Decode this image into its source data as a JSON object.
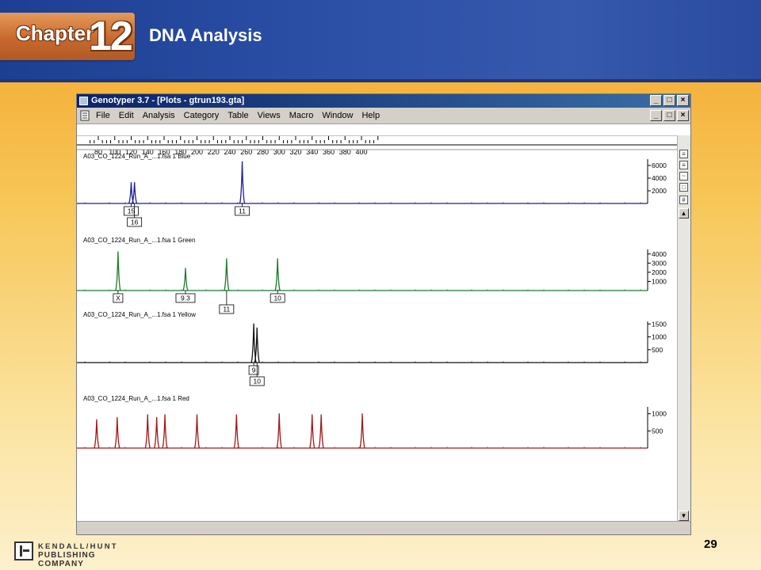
{
  "header": {
    "chapter_word": "Chapter",
    "chapter_number": "12",
    "title": "DNA Analysis"
  },
  "window": {
    "title": "Genotyper 3.7 - [Plots - gtrun193.gta]",
    "controls": [
      "_",
      "□",
      "×"
    ]
  },
  "menubar": {
    "items": [
      "File",
      "Edit",
      "Analysis",
      "Category",
      "Table",
      "Views",
      "Macro",
      "Window",
      "Help"
    ]
  },
  "ruler": {
    "ticks": [
      "80",
      "100",
      "120",
      "140",
      "160",
      "180",
      "200",
      "220",
      "240",
      "260",
      "280",
      "300",
      "320",
      "340",
      "360",
      "380",
      "400"
    ]
  },
  "panels": [
    {
      "label": "A03_CO_1224_Run_A_...1.fsa  1 Blue",
      "color": "#1f1f8f",
      "y_ticks": [
        "6000",
        "4000",
        "2000"
      ],
      "y_tick_values": [
        6000,
        4000,
        2000
      ],
      "y_max": 7000,
      "peaks": [
        {
          "x": 120,
          "h": 0.48
        },
        {
          "x": 124,
          "h": 0.48
        },
        {
          "x": 255,
          "h": 0.95
        }
      ],
      "alleles": [
        {
          "x": 120,
          "label": "15",
          "row": 0
        },
        {
          "x": 124,
          "label": "16",
          "row": 1
        },
        {
          "x": 255,
          "label": "11",
          "row": 0
        }
      ]
    },
    {
      "label": "A03_CO_1224_Run_A_...1.fsa  1 Green",
      "color": "#1a7a2a",
      "y_ticks": [
        "4000",
        "3000",
        "2000",
        "1000"
      ],
      "y_tick_values": [
        4000,
        3000,
        2000,
        1000
      ],
      "y_max": 4500,
      "peaks": [
        {
          "x": 104,
          "h": 0.95
        },
        {
          "x": 186,
          "h": 0.55
        },
        {
          "x": 236,
          "h": 0.78
        },
        {
          "x": 298,
          "h": 0.78
        }
      ],
      "alleles": [
        {
          "x": 104,
          "label": "X",
          "row": 0
        },
        {
          "x": 186,
          "label": "9.3",
          "row": 0
        },
        {
          "x": 236,
          "label": "11",
          "row": 1
        },
        {
          "x": 298,
          "label": "10",
          "row": 0
        }
      ]
    },
    {
      "label": "A03_CO_1224_Run_A_...1.fsa  1 Yellow",
      "color": "#111111",
      "y_ticks": [
        "1500",
        "1000",
        "500"
      ],
      "y_tick_values": [
        1500,
        1000,
        500
      ],
      "y_max": 1600,
      "peaks": [
        {
          "x": 269,
          "h": 0.95
        },
        {
          "x": 273,
          "h": 0.85
        }
      ],
      "alleles": [
        {
          "x": 269,
          "label": "9",
          "row": 0
        },
        {
          "x": 273,
          "label": "10",
          "row": 1
        }
      ]
    },
    {
      "label": "A03_CO_1224_Run_A_...1.fsa  1 Red",
      "color": "#a01818",
      "y_ticks": [
        "1000",
        "500"
      ],
      "y_tick_values": [
        1000,
        500
      ],
      "y_max": 1200,
      "peaks": [
        {
          "x": 78,
          "h": 0.7
        },
        {
          "x": 103,
          "h": 0.75
        },
        {
          "x": 140,
          "h": 0.82
        },
        {
          "x": 151,
          "h": 0.75
        },
        {
          "x": 161,
          "h": 0.82
        },
        {
          "x": 200,
          "h": 0.82
        },
        {
          "x": 248,
          "h": 0.82
        },
        {
          "x": 300,
          "h": 0.84
        },
        {
          "x": 340,
          "h": 0.82
        },
        {
          "x": 351,
          "h": 0.82
        },
        {
          "x": 401,
          "h": 0.84
        }
      ],
      "alleles": []
    }
  ],
  "footer": {
    "publisher_line1": "KENDALL/HUNT",
    "publisher_line2": "PUBLISHING COMPANY",
    "page_number": "29"
  }
}
